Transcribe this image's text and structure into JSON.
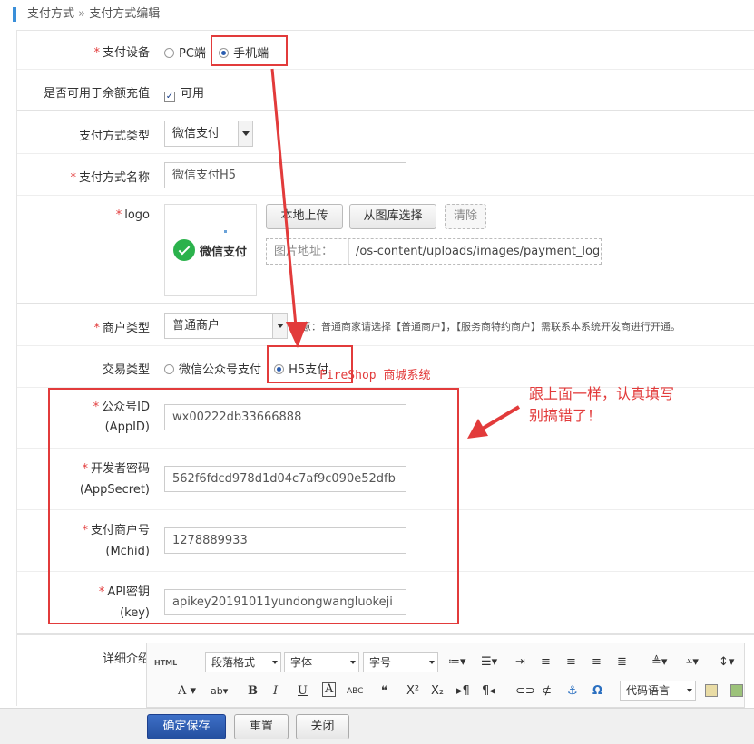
{
  "breadcrumb": {
    "parent": "支付方式",
    "separator": "»",
    "current": "支付方式编辑"
  },
  "form": {
    "device": {
      "label": "支付设备",
      "options": [
        "PC端",
        "手机端"
      ],
      "selected": "手机端"
    },
    "recharge": {
      "label": "是否可用于余额充值",
      "checkbox_label": "可用",
      "checked": true
    },
    "pay_type": {
      "label": "支付方式类型",
      "value": "微信支付"
    },
    "pay_name": {
      "label": "支付方式名称",
      "value": "微信支付H5"
    },
    "logo": {
      "label": "logo",
      "preview_text": "微信支付",
      "upload_local": "本地上传",
      "choose_gallery": "从图库选择",
      "clear": "清除",
      "path_label": "图片地址：",
      "path_value": "/os-content/uploads/images/payment_logo/"
    },
    "merchant_type": {
      "label": "商户类型",
      "value": "普通商户",
      "hint": "意：普通商家请选择【普通商户】，【服务商特约商户】需联系本系统开发商进行开通。"
    },
    "trade_type": {
      "label": "交易类型",
      "options": [
        "微信公众号支付",
        "H5支付"
      ],
      "selected": "H5支付"
    },
    "appid": {
      "label": "公众号ID",
      "sub": "(AppID)",
      "value": "wx00222db33666888"
    },
    "appsecret": {
      "label": "开发者密码",
      "sub": "(AppSecret)",
      "value": "562f6fdcd978d1d04c7af9c090e52dfb"
    },
    "mchid": {
      "label": "支付商户号",
      "sub": "(Mchid)",
      "value": "1278889933"
    },
    "apikey": {
      "label": "API密钥",
      "sub": "(key)",
      "value": "apikey20191011yundongwangluokeji"
    },
    "detail": {
      "label": "详细介绍"
    }
  },
  "editor": {
    "html_btn": "HTML",
    "paragraph": "段落格式",
    "font": "字体",
    "size": "字号",
    "code_lang": "代码语言"
  },
  "annotation": {
    "watermark": "FireShop 商城系统",
    "note_line1": "跟上面一样，认真填写",
    "note_line2": "别搞错了！",
    "color": "#e23b3b"
  },
  "actions": {
    "save": "确定保存",
    "reset": "重置",
    "close": "关闭"
  }
}
